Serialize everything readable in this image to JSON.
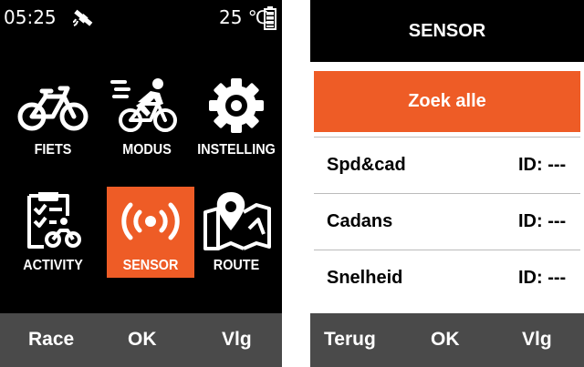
{
  "menu_screen": {
    "status": {
      "time": "05:25",
      "temperature": "25 ℃"
    },
    "tiles": [
      {
        "label": "FIETS",
        "icon": "bike-icon",
        "selected": false
      },
      {
        "label": "MODUS",
        "icon": "cyclist-icon",
        "selected": false
      },
      {
        "label": "INSTELLING",
        "icon": "gear-icon",
        "selected": false
      },
      {
        "label": "ACTIVITY",
        "icon": "activity-clipboard-icon",
        "selected": false
      },
      {
        "label": "SENSOR",
        "icon": "sensor-signal-icon",
        "selected": true
      },
      {
        "label": "ROUTE",
        "icon": "map-pin-icon",
        "selected": false
      }
    ],
    "softkeys": {
      "left": "Race",
      "center": "OK",
      "right": "Vlg"
    }
  },
  "sensor_screen": {
    "title": "SENSOR",
    "search_button": "Zoek alle",
    "sensors": [
      {
        "name": "Spd&cad",
        "id": "ID: ---"
      },
      {
        "name": "Cadans",
        "id": "ID: ---"
      },
      {
        "name": "Snelheid",
        "id": "ID: ---"
      }
    ],
    "softkeys": {
      "left": "Terug",
      "center": "OK",
      "right": "Vlg"
    }
  },
  "colors": {
    "accent": "#ee5c26",
    "screen_bg": "#000000",
    "softbar_bg": "#4a4a4a"
  }
}
